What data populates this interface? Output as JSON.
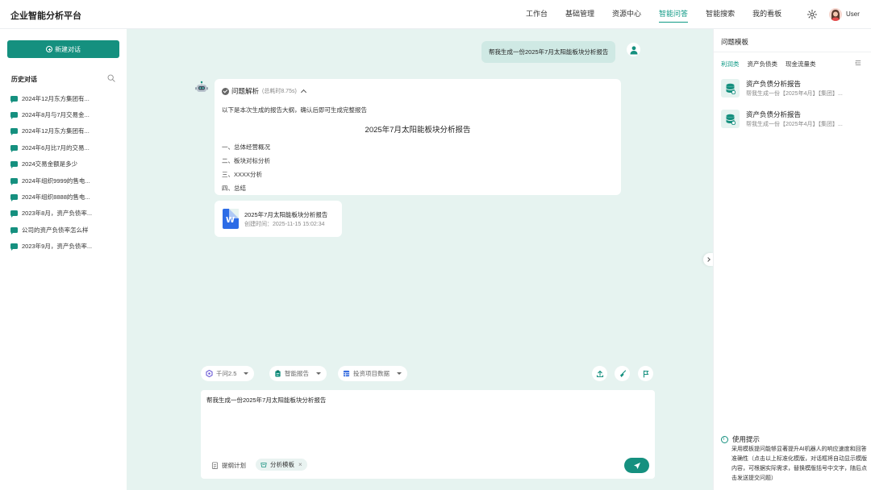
{
  "header": {
    "app_title": "企业智能分析平台",
    "nav": [
      "工作台",
      "基础管理",
      "资源中心",
      "智能问答",
      "智能搜索",
      "我的看板"
    ],
    "active_nav": "智能问答",
    "user_name": "User"
  },
  "sidebar": {
    "new_chat_label": "新建对话",
    "history_title": "历史对话",
    "history": [
      "2024年12月东方集团有...",
      "2024年8月与7月交易金...",
      "2024年12月东方集团有...",
      "2024年6月比7月的交易...",
      "2024交易金额是多少",
      "2024年组织9999的售电...",
      "2024年组织8888的售电...",
      "2023年8月，资产负债率...",
      "公司的资产负债率怎么样",
      "2023年9月，资产负债率..."
    ]
  },
  "chat": {
    "user_message": "帮我生成一份2025年7月太阳能板块分析报告",
    "answer": {
      "label": "问题解析",
      "time": "(总耗时8.75s)",
      "intro": "以下是本次生成的报告大纲，确认后即可生成完整报告",
      "title": "2025年7月太阳能板块分析报告",
      "outline": [
        "一、总体经营概况",
        "二、板块对标分析",
        "三、XXXX分析",
        "四、总结"
      ]
    },
    "file": {
      "name": "2025年7月太阳能板块分析报告",
      "created": "创建时间：2025-11-15 15:02:34"
    }
  },
  "toolbar": {
    "model": "千问2.5",
    "mode": "智能报告",
    "data_source": "投资项目数据"
  },
  "input": {
    "text": "帮我生成一份2025年7月太阳能板块分析报告",
    "outline_plan": "提纲计划",
    "template_tag": "分析模板"
  },
  "right_panel": {
    "title": "问题模板",
    "tabs": [
      "利润类",
      "资产负债类",
      "现金流量类"
    ],
    "active_tab": "利润类",
    "templates": [
      {
        "name": "资产负债分析报告",
        "desc": "帮我生成一份【2025年4月】【集团】..."
      },
      {
        "name": "资产负债分析报告",
        "desc": "帮我生成一份【2025年4月】【集团】..."
      }
    ],
    "tip_title": "使用提示",
    "tip_text": "采用模板提问能够显著提升AI机器人的响应速度和回答准确性（点击以上标准化模版，对话框将自动显示模版内容，可根据实际需求，替换模版括号中文字，随后点击发送提交问题）"
  },
  "colors": {
    "accent": "#15907f",
    "main_bg": "#e6f3f0",
    "user_bubble": "#cfe9e4"
  }
}
